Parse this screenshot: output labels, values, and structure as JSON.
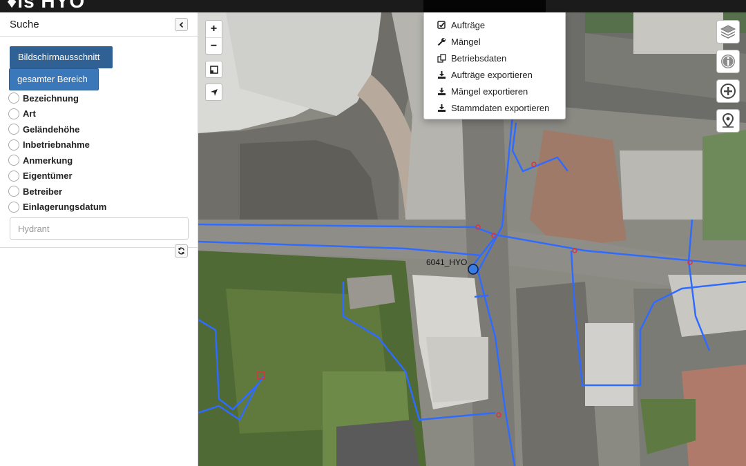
{
  "app": {
    "brand": "♦ls HYO"
  },
  "sidebar": {
    "title": "Suche",
    "buttons": {
      "viewport": "Bildschirmausschnitt",
      "full_area": "gesamter Bereich"
    },
    "radio_options": [
      "Bezeichnung",
      "Art",
      "Geländehöhe",
      "Inbetriebnahme",
      "Anmerkung",
      "Eigentümer",
      "Betreiber",
      "Einlagerungsdatum"
    ],
    "search": {
      "value": "",
      "placeholder": "Hydrant"
    }
  },
  "map": {
    "zoom_in": "+",
    "zoom_out": "−",
    "hydrant_label": "6041_HYO",
    "colors": {
      "pipe": "#2f6bff",
      "hydrant": "#3a7de0",
      "marker": "#e0303a"
    }
  },
  "dropdown": {
    "items": [
      {
        "label": "Aufträge",
        "icon": "checkbox-icon"
      },
      {
        "label": "Mängel",
        "icon": "wrench-icon"
      },
      {
        "label": "Betriebsdaten",
        "icon": "copy-icon"
      },
      {
        "label": "Aufträge exportieren",
        "icon": "download-icon"
      },
      {
        "label": "Mängel exportieren",
        "icon": "download-icon"
      },
      {
        "label": "Stammdaten exportieren",
        "icon": "download-icon"
      }
    ]
  }
}
